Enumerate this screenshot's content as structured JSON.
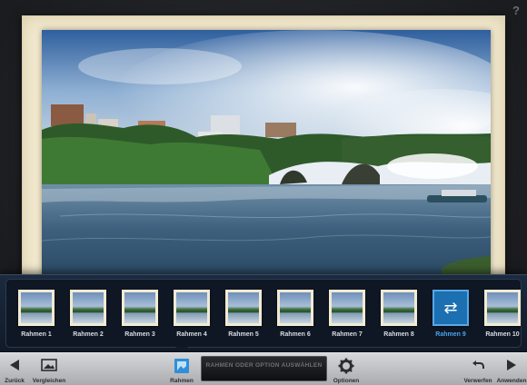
{
  "help": {
    "label": "?"
  },
  "filmstrip": {
    "items": [
      {
        "label": "Rahmen 1",
        "selected": false
      },
      {
        "label": "Rahmen 2",
        "selected": false
      },
      {
        "label": "Rahmen 3",
        "selected": false
      },
      {
        "label": "Rahmen 4",
        "selected": false
      },
      {
        "label": "Rahmen 5",
        "selected": false
      },
      {
        "label": "Rahmen 6",
        "selected": false
      },
      {
        "label": "Rahmen 7",
        "selected": false
      },
      {
        "label": "Rahmen 8",
        "selected": false
      },
      {
        "label": "Rahmen 9",
        "selected": true,
        "icon": "shuffle-icon"
      },
      {
        "label": "Rahmen 10",
        "selected": false
      }
    ]
  },
  "toolbar": {
    "back_label": "Zurück",
    "compare_label": "Vergleichen",
    "frames_label": "Rahmen",
    "status_text": "RAHMEN ODER OPTION AUSWÄHLEN",
    "options_label": "Optionen",
    "discard_label": "Verwerfen",
    "apply_label": "Anwenden"
  },
  "colors": {
    "selection_accent": "#4aa3ee",
    "frame_paper": "#f3ead0",
    "toolbar_bg": "#c4c5c8"
  }
}
